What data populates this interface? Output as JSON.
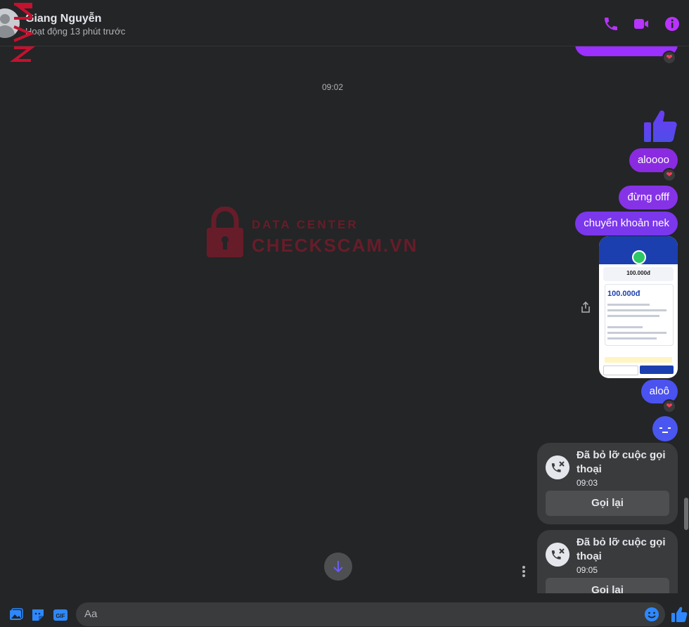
{
  "header": {
    "contact_name": "Giang Nguyễn",
    "status": "Hoạt động 13 phút trước",
    "icons": [
      "phone-icon",
      "video-icon",
      "info-icon"
    ]
  },
  "chat": {
    "time_separator": "09:02",
    "messages": [
      {
        "type": "like",
        "icon": "thumbs-up-icon"
      },
      {
        "type": "text",
        "text": "aloooo",
        "reaction": "heart"
      },
      {
        "type": "text",
        "text": "đừng offf"
      },
      {
        "type": "text",
        "text": "chuyển khoản nek"
      },
      {
        "type": "image",
        "description_icon": "transfer-receipt-image",
        "amount": "100.000đ"
      },
      {
        "type": "text",
        "text": "aloô",
        "reaction": "heart"
      },
      {
        "type": "emoji",
        "icon": "crying-face-icon"
      }
    ],
    "calls": [
      {
        "title": "Đã bỏ lỡ cuộc gọi thoại",
        "time": "09:03",
        "button": "Gọi lại"
      },
      {
        "title": "Đã bỏ lỡ cuộc gọi thoại",
        "time": "09:05",
        "button": "Gọi lại"
      }
    ],
    "watermark": {
      "small": "DATA CENTER",
      "big": "CHECKSCAM.VN"
    }
  },
  "composer": {
    "placeholder": "Aa",
    "icons": [
      "image-icon",
      "sticker-icon",
      "gif-icon",
      "emoji-icon",
      "like-icon"
    ]
  },
  "colors": {
    "accent": "#a033ff",
    "bubble_purple": "#8a2be2",
    "bubble_blue": "#4a52f0",
    "background": "#242526"
  }
}
